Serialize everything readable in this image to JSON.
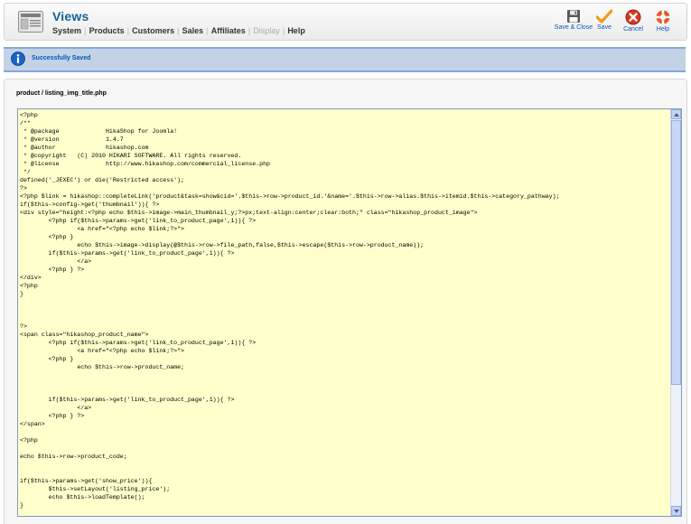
{
  "header": {
    "title": "Views",
    "menu": [
      {
        "label": "System",
        "disabled": false
      },
      {
        "label": "Products",
        "disabled": false
      },
      {
        "label": "Customers",
        "disabled": false
      },
      {
        "label": "Sales",
        "disabled": false
      },
      {
        "label": "Affiliates",
        "disabled": false
      },
      {
        "label": "Display",
        "disabled": true
      },
      {
        "label": "Help",
        "disabled": false
      }
    ]
  },
  "toolbar": {
    "save_close_label": "Save & Close",
    "save_label": "Save",
    "cancel_label": "Cancel",
    "help_label": "Help"
  },
  "message": {
    "text": "Successfully Saved"
  },
  "editor": {
    "filename": "product / listing_img_title.php",
    "code": "<?php\n/**\n * @package\t\tHikaShop for Joomla!\n * @version\t\t1.4.7\n * @author\t\thikashop.com\n * @copyright\t(C) 2010 HIKARI SOFTWARE. All rights reserved.\n * @license\t\thttp://www.hikashop.com/commercial_license.php\n */\ndefined('_JEXEC') or die('Restricted access');\n?>\n<?php $link = hikashop::completeLink('product&task=show&cid='.$this->row->product_id.'&name='.$this->row->alias.$this->itemid.$this->category_pathway);\nif($this->config->get('thumbnail')){ ?>\n<div style=\"height:<?php echo $this->image->main_thumbnail_y;?>px;text-align:center;clear:both;\" class=\"hikashop_product_image\">\n\t<?php if($this->params->get('link_to_product_page',1)){ ?>\n\t\t<a href=\"<?php echo $link;?>\">\n\t<?php }\n\t\techo $this->image->display(@$this->row->file_path,false,$this->escape($this->row->product_name));\n\tif($this->params->get('link_to_product_page',1)){ ?>\n\t\t</a>\n\t<?php } ?>\n</div>\n<?php\n}\n\n\n\n?>\n<span class=\"hikashop_product_name\">\n\t<?php if($this->params->get('link_to_product_page',1)){ ?>\n\t\t<a href=\"<?php echo $link;?>\">\n\t<?php }\n\t\techo $this->row->product_name;\n\n\n\n\tif($this->params->get('link_to_product_page',1)){ ?>\n\t\t</a>\n\t<?php } ?>\n</span>\n\n<?php\n\necho $this->row->product_code;\n\n\nif($this->params->get('show_price')){\n\t$this->setLayout('listing_price');\n\techo $this->loadTemplate();\n}"
  },
  "colors": {
    "title": "#146295",
    "link": "#0b55c4",
    "message_bg": "#c3d2e5",
    "message_text": "#0055bb",
    "editor_bg": "#ffffcc",
    "save_check": "#f29a1a",
    "cancel_red": "#d9361c",
    "help_orange": "#e8551e"
  },
  "icons": {
    "logo": "views-icon",
    "save_close": "floppy-disk-icon",
    "save": "checkmark-icon",
    "cancel": "cancel-icon",
    "help": "help-lifebuoy-icon",
    "message": "info-icon"
  }
}
